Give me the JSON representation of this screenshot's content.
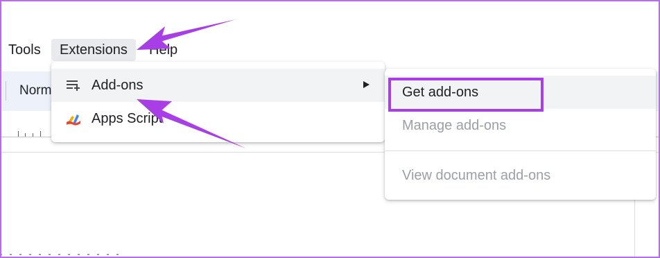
{
  "menubar": {
    "tools": "Tools",
    "extensions": "Extensions",
    "help": "Help"
  },
  "toolbar": {
    "style_select": "Norm"
  },
  "extensions_menu": {
    "items": [
      {
        "label": "Add-ons",
        "icon": "addons-icon",
        "has_submenu": true
      },
      {
        "label": "Apps Script",
        "icon": "apps-script-icon",
        "has_submenu": false
      }
    ]
  },
  "addons_submenu": {
    "items": [
      {
        "label": "Get add-ons",
        "enabled": true
      },
      {
        "label": "Manage add-ons",
        "enabled": false
      },
      {
        "label": "View document add-ons",
        "enabled": false
      }
    ]
  },
  "colors": {
    "annotation": "#a83ee6",
    "menu_hover": "#f1f3f4",
    "disabled_text": "#9aa0a6"
  }
}
